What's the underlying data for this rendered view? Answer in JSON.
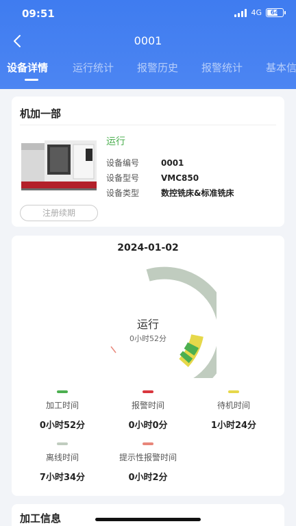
{
  "status_bar": {
    "time": "09:51",
    "network": "4G",
    "battery": "64"
  },
  "nav": {
    "title": "0001"
  },
  "tabs": [
    {
      "label": "设备详情"
    },
    {
      "label": "运行统计"
    },
    {
      "label": "报警历史"
    },
    {
      "label": "报警统计"
    },
    {
      "label": "基本信"
    }
  ],
  "device": {
    "department": "机加一部",
    "status": "运行",
    "fields": [
      {
        "key": "设备编号",
        "value": "0001"
      },
      {
        "key": "设备型号",
        "value": "VMC850"
      },
      {
        "key": "设备类型",
        "value": "数控铣床&标准铣床"
      }
    ],
    "renew_label": "注册续期"
  },
  "stats": {
    "date": "2024-01-02",
    "center_status": "运行",
    "center_duration": "0小时52分",
    "colors": {
      "processing": "#4caf50",
      "alarm": "#d9363e",
      "standby": "#e6d84a",
      "offline": "#c0ccbf",
      "hint_alarm": "#e8867a"
    },
    "items": [
      {
        "label": "加工时间",
        "value": "0小时52分",
        "color": "#4caf50"
      },
      {
        "label": "报警时间",
        "value": "0小时0分",
        "color": "#d9363e"
      },
      {
        "label": "待机时间",
        "value": "1小时24分",
        "color": "#e6d84a"
      },
      {
        "label": "离线时间",
        "value": "7小时34分",
        "color": "#c0ccbf"
      },
      {
        "label": "提示性报警时间",
        "value": "0小时2分",
        "color": "#e8867a"
      }
    ]
  },
  "processing_section": {
    "title": "加工信息"
  }
}
